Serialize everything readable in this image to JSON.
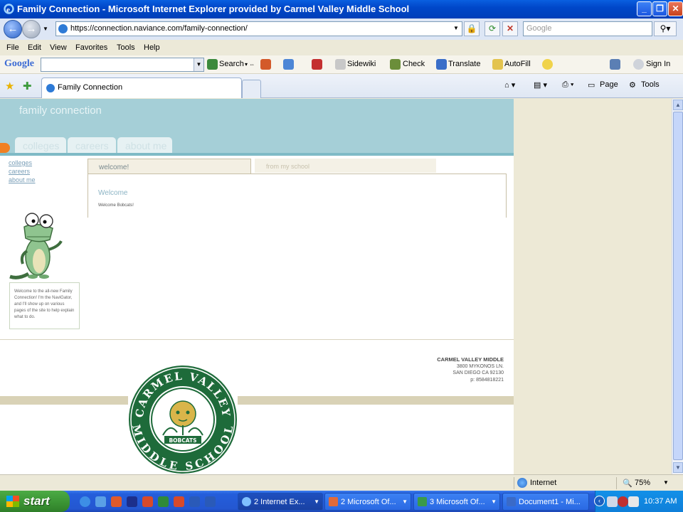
{
  "window": {
    "title": "Family Connection - Microsoft Internet Explorer provided by Carmel Valley Middle School"
  },
  "address": {
    "url": "https://connection.naviance.com/family-connection/",
    "search_placeholder": "Google"
  },
  "menu": {
    "items": [
      "File",
      "Edit",
      "View",
      "Favorites",
      "Tools",
      "Help"
    ]
  },
  "google_toolbar": {
    "logo": "Google",
    "search": "Search",
    "sidewiki": "Sidewiki",
    "check": "Check",
    "translate": "Translate",
    "autofill": "AutoFill",
    "sign_in": "Sign In"
  },
  "tabs": {
    "active": "Family Connection",
    "page": "Page",
    "tools": "Tools"
  },
  "site": {
    "title": "family connection",
    "nav_tabs": [
      "colleges",
      "careers",
      "about me"
    ],
    "side_links": [
      "colleges",
      "careers",
      "about me"
    ],
    "content_tabs": [
      "welcome!",
      "from my school"
    ],
    "welcome_heading": "Welcome",
    "welcome_body": "Welcome Bobcats!",
    "navigator_text": "Welcome to the all-new Family Connection! I'm the NaviGator, and I'll show up on various pages of the site to help explain what to do.",
    "school": {
      "name": "CARMEL VALLEY MIDDLE",
      "street": "3800 MYKONOS LN.",
      "city": "SAN DIEGO CA 92130",
      "phone": "p: 8584818221"
    },
    "seal": {
      "top": "CARMEL VALLEY",
      "bottom": "MIDDLE SCHOOL",
      "banner": "BOBCATS"
    }
  },
  "status": {
    "zone": "Internet",
    "zoom": "75%"
  },
  "taskbar": {
    "start": "start",
    "tasks": [
      "2 Internet Ex...",
      "2 Microsoft Of...",
      "3 Microsoft Of...",
      "Document1 - Mi..."
    ],
    "time": "10:37 AM"
  },
  "colors": {
    "header": "#a5cfd7",
    "accent": "#f08022",
    "seal_green": "#1e6b3a",
    "seal_gold": "#d9b54a"
  }
}
